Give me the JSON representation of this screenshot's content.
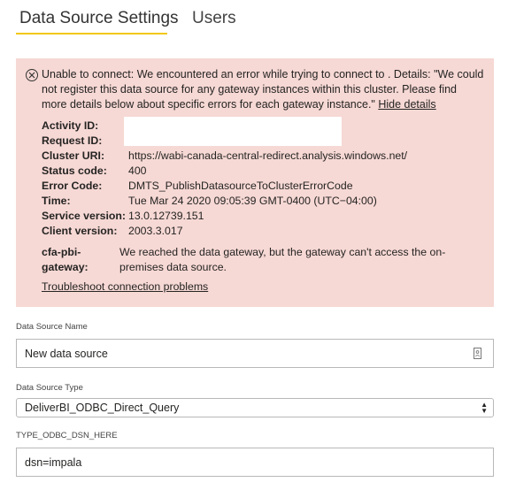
{
  "tabs": [
    {
      "label": "Data Source Settings",
      "active": true
    },
    {
      "label": "Users",
      "active": false
    }
  ],
  "error": {
    "message": "Unable to connect: We encountered an error while trying to connect to . Details: \"We could not register this data source for any gateway instances within this cluster. Please find more details below about specific errors for each gateway instance.\"",
    "hide_details_label": "Hide details",
    "details": [
      {
        "key": "Activity ID:",
        "value": ""
      },
      {
        "key": "Request ID:",
        "value": ""
      },
      {
        "key": "Cluster URI:",
        "value": "https://wabi-canada-central-redirect.analysis.windows.net/"
      },
      {
        "key": "Status code:",
        "value": "400"
      },
      {
        "key": "Error Code:",
        "value": "DMTS_PublishDatasourceToClusterErrorCode"
      },
      {
        "key": "Time:",
        "value": "Tue Mar 24 2020 09:05:39 GMT-0400 (UTC−04:00)"
      },
      {
        "key": "Service version:",
        "value": "13.0.12739.151"
      },
      {
        "key": "Client version:",
        "value": "2003.3.017"
      }
    ],
    "gateway": {
      "key": "cfa-pbi-gateway:",
      "value": "We reached the data gateway, but the gateway can't access the on-premises data source."
    },
    "troubleshoot_label": "Troubleshoot connection problems",
    "background_color": "#f6d8d4"
  },
  "form": {
    "data_source_name": {
      "label": "Data Source Name",
      "value": "New data source"
    },
    "data_source_type": {
      "label": "Data Source Type",
      "value": "DeliverBI_ODBC_Direct_Query"
    },
    "dsn": {
      "label": "TYPE_ODBC_DSN_HERE",
      "value": "dsn=impala"
    }
  },
  "accent_color": "#f2c811"
}
